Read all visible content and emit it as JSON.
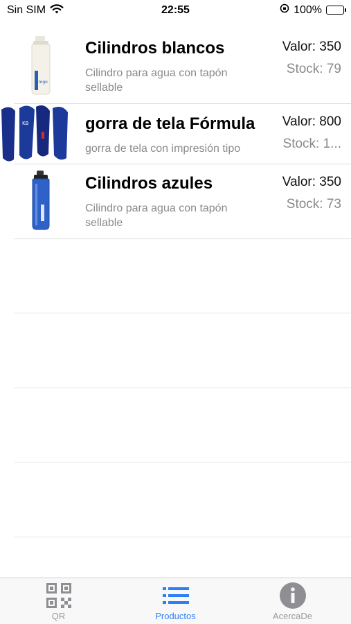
{
  "status_bar": {
    "carrier": "Sin SIM",
    "time": "22:55",
    "battery": "100%"
  },
  "products": [
    {
      "title": "Cilindros blancos",
      "description": "Cilindro para agua con tapón sellable",
      "price": "Valor: 350",
      "stock": "Stock: 79",
      "image": "white-bottle"
    },
    {
      "title": "gorra de tela Fórmula",
      "description": "gorra de tela con impresión tipo",
      "price": "Valor: 800",
      "stock": "Stock: 1...",
      "image": "blue-caps"
    },
    {
      "title": "Cilindros azules",
      "description": "Cilindro para agua con tapón sellable",
      "price": "Valor: 350",
      "stock": "Stock: 73",
      "image": "blue-bottle"
    }
  ],
  "tabs": [
    {
      "label": "QR",
      "icon": "qr-code-icon",
      "active": false
    },
    {
      "label": "Productos",
      "icon": "list-icon",
      "active": true
    },
    {
      "label": "AcercaDe",
      "icon": "info-icon",
      "active": false
    }
  ],
  "colors": {
    "accent": "#2d7ff9",
    "inactive": "#9a9a9a",
    "secondary_text": "#8a8a8e"
  }
}
